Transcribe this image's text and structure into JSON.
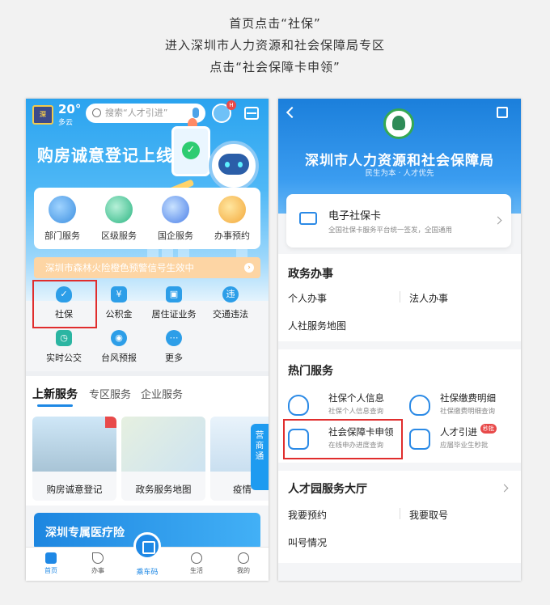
{
  "captions": [
    "首页点击“社保”",
    "进入深圳市人力资源和社会保障局专区",
    "点击“社会保障卡申领”"
  ],
  "left": {
    "weather": {
      "temp": "20°",
      "desc": "多云"
    },
    "search_placeholder": "搜索“人才引进”",
    "robot_badge": "H",
    "banner_title": "购房诚意登记上线",
    "quick_services": [
      "部门服务",
      "区级服务",
      "国企服务",
      "办事预约"
    ],
    "alert": "深圳市森林火险橙色预警信号生效中",
    "grid": [
      {
        "label": "社保",
        "icon": "shield-icon",
        "glyph": "✓"
      },
      {
        "label": "公积金",
        "icon": "house-icon",
        "glyph": "¥"
      },
      {
        "label": "居住证业务",
        "icon": "id-card-icon",
        "glyph": "▣"
      },
      {
        "label": "交通违法",
        "icon": "traffic-icon",
        "glyph": "违"
      },
      {
        "label": "实时公交",
        "icon": "bus-icon",
        "glyph": "◷"
      },
      {
        "label": "台风预报",
        "icon": "typhoon-icon",
        "glyph": "◉"
      },
      {
        "label": "更多",
        "icon": "more-icon",
        "glyph": "⋯"
      }
    ],
    "tabs": [
      "上新服务",
      "专区服务",
      "企业服务"
    ],
    "cards": [
      "购房诚意登记",
      "政务服务地图",
      "疫情"
    ],
    "side_tab": "营商通",
    "medical_banner": "深圳专属医疗险",
    "nav": [
      "首页",
      "办事",
      "乘车码",
      "生活",
      "我的"
    ]
  },
  "right": {
    "title": "深圳市人力资源和社会保障局",
    "slogan": "民生为本 · 人才优先",
    "ecard": {
      "title": "电子社保卡",
      "subtitle": "全国社保卡服务平台统一签发，全国通用"
    },
    "gov": {
      "title": "政务办事",
      "items": [
        "个人办事",
        "法人办事",
        "人社服务地图"
      ]
    },
    "hot": {
      "title": "热门服务",
      "items": [
        {
          "title": "社保个人信息",
          "sub": "社保个人信息查询",
          "icon": "person-shield-icon"
        },
        {
          "title": "社保缴费明细",
          "sub": "社保缴费明细查询",
          "icon": "check-shield-icon"
        },
        {
          "title": "社会保障卡申领",
          "sub": "在线申办进度查询",
          "icon": "card-apply-icon"
        },
        {
          "title": "人才引进",
          "sub": "应届毕业生秒批",
          "icon": "talent-icon",
          "badge": "秒批"
        }
      ]
    },
    "hall": {
      "title": "人才园服务大厅",
      "items": [
        "我要预约",
        "我要取号",
        "叫号情况"
      ]
    }
  }
}
